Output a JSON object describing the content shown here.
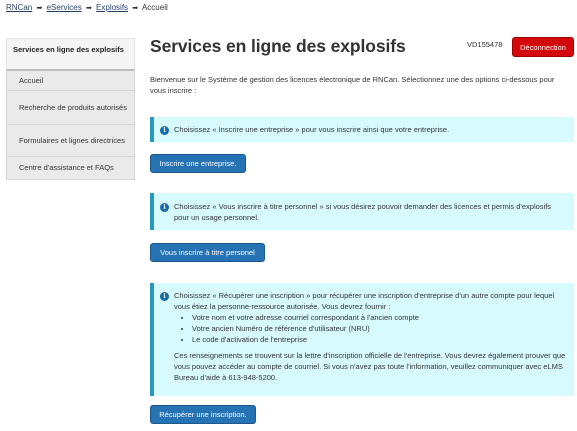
{
  "breadcrumb": {
    "items": [
      "RNCan",
      "eServices",
      "Explosifs"
    ],
    "separator": "➡",
    "current": "Accueil"
  },
  "sidebar": {
    "title": "Services en ligne des explosifs",
    "items": [
      {
        "label": "Accueil"
      },
      {
        "label": "Recherche de produits autorisés"
      },
      {
        "label": "Formulaires et lignes directrices"
      },
      {
        "label": "Centre d'assistance et FAQs"
      }
    ]
  },
  "header": {
    "title": "Services en ligne des explosifs",
    "user_code": "VD155478",
    "logout_label": "Déconnection"
  },
  "intro": "Bienvenue sur le Système de gestion des licences électronique de RNCan. Sélectionnez une des options ci-dessous pour vous inscrire :",
  "info_icon_glyph": "i",
  "options": [
    {
      "info": "Choisissez « Inscrire une entreprise » pour vous inscrire ainsi que votre entreprise.",
      "button_label": "Inscrire une entreprise."
    },
    {
      "info": "Choisissez « Vous inscrire à titre personnel » si vous désirez pouvoir demander des licences et permis d'explosifs pour un usage personnel.",
      "button_label": "Vous inscrire à titre personel"
    },
    {
      "info": "Choisissez « Récupérer une inscription » pour récupérer une inscription d'entreprise d'un autre compte pour lequel vous étiez la personne-ressource autorisée. Vous devrez fournir :",
      "bullets": [
        "Votre nom et votre adresse courriel correspondant à l'ancien compte",
        "Votre ancien Numéro de référence d'utilisateur (NRU)",
        "Le code d'activation de l'entreprise"
      ],
      "info_extra": "Ces renseignements se trouvent sur la lettre d'inscription officielle de l'entreprise. Vous devrez également prouver que vous pouvez accéder au compte de courriel. Si vous n'avez pas toute l'information, veuillez communiquer avec eLMS Bureau d'aide à 613-948-5200.",
      "button_label": "Récupérer une inscription."
    }
  ],
  "colors": {
    "link": "#284162",
    "alert_bg": "#d7faff",
    "alert_border": "#269abc",
    "primary_button": "#2572b4",
    "danger_button": "#d3080c"
  }
}
